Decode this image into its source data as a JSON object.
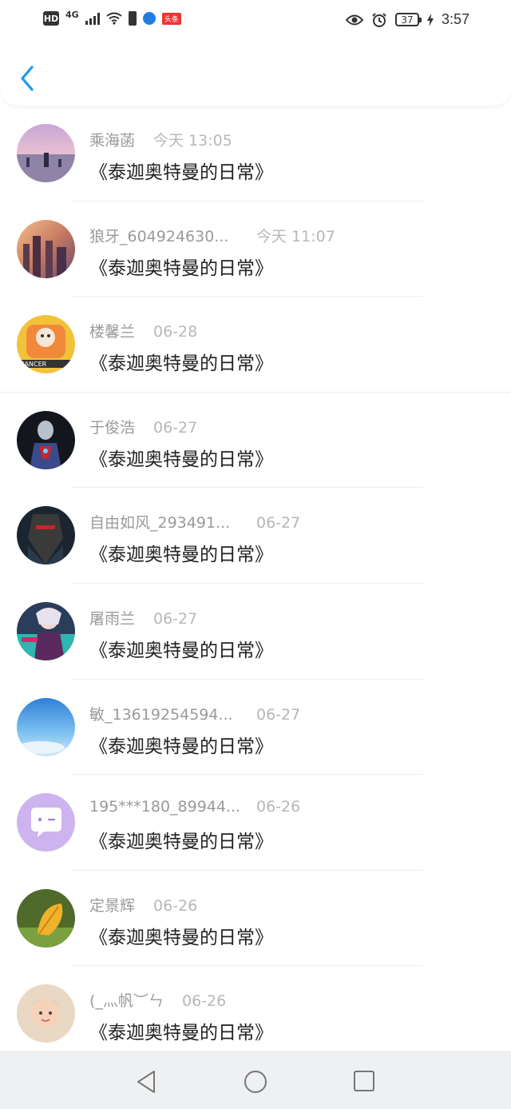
{
  "status_bar": {
    "hd": "HD",
    "network": "4G",
    "news_tag": "头条",
    "battery": "37",
    "time": "3:57"
  },
  "header": {
    "back_icon": "chevron-left-icon",
    "accent_color": "#1a9af0"
  },
  "items": [
    {
      "name": "乘海菡",
      "time": "今天 13:05",
      "message": "《泰迦奥特曼的日常》",
      "avatar": "sea-sunset"
    },
    {
      "name": "狼牙_604924630...",
      "time": "今天 11:07",
      "message": "《泰迦奥特曼的日常》",
      "avatar": "city-sunset"
    },
    {
      "name": "楼馨兰",
      "time": "06-28",
      "message": "《泰迦奥特曼的日常》",
      "avatar": "cancer-cartoon"
    },
    {
      "name": "于俊浩",
      "time": "06-27",
      "message": "《泰迦奥特曼的日常》",
      "avatar": "ultraman"
    },
    {
      "name": "自由如风_293491...",
      "time": "06-27",
      "message": "《泰迦奥特曼的日常》",
      "avatar": "dark-warrior"
    },
    {
      "name": "屠雨兰",
      "time": "06-27",
      "message": "《泰迦奥特曼的日常》",
      "avatar": "anime-girl"
    },
    {
      "name": "敏_13619254594...",
      "time": "06-27",
      "message": "《泰迦奥特曼的日常》",
      "avatar": "blue-sky"
    },
    {
      "name": "195***180_89944...",
      "time": "06-26",
      "message": "《泰迦奥特曼的日常》",
      "avatar": "chat-bubble-purple"
    },
    {
      "name": "定景辉",
      "time": "06-26",
      "message": "《泰迦奥特曼的日常》",
      "avatar": "autumn-leaf"
    },
    {
      "name": "(_灬帆︶ㄣ",
      "time": "06-26",
      "message": "《泰迦奥特曼的日常》",
      "avatar": "baby"
    }
  ],
  "navbar": {
    "back": "triangle-back-icon",
    "home": "circle-home-icon",
    "recent": "square-recent-icon"
  }
}
